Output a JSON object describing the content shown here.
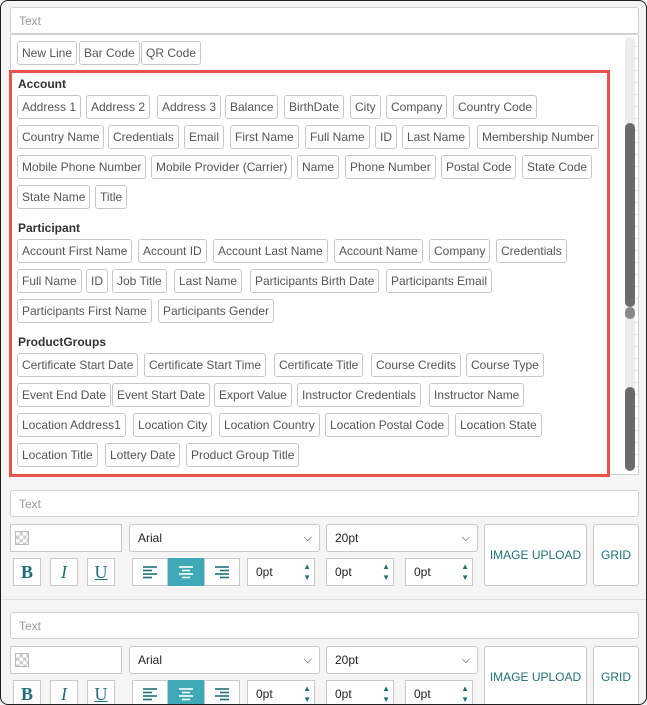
{
  "top_text_placeholder": "Text",
  "basic_chips": [
    "New Line",
    "Bar Code",
    "QR Code"
  ],
  "groups": {
    "account": {
      "title": "Account",
      "items": [
        "Address 1",
        "Address 2",
        "Address 3",
        "Balance",
        "BirthDate",
        "City",
        "Company",
        "Country Code",
        "Country Name",
        "Credentials",
        "Email",
        "First Name",
        "Full Name",
        "ID",
        "Last Name",
        "Membership Number",
        "Mobile Phone Number",
        "Mobile Provider (Carrier)",
        "Name",
        "Phone Number",
        "Postal Code",
        "State Code",
        "State Name",
        "Title"
      ]
    },
    "participant": {
      "title": "Participant",
      "items": [
        "Account First Name",
        "Account ID",
        "Account Last Name",
        "Account Name",
        "Company",
        "Credentials",
        "Full Name",
        "ID",
        "Job Title",
        "Last Name",
        "Participants Birth Date",
        "Participants Email",
        "Participants First Name",
        "Participants Gender"
      ]
    },
    "productgroups": {
      "title": "ProductGroups",
      "items": [
        "Certificate Start Date",
        "Certificate Start Time",
        "Certificate Title",
        "Course Credits",
        "Course Type",
        "Event End Date",
        "Event Start Date",
        "Export Value",
        "Instructor Credentials",
        "Instructor Name",
        "Location Address1",
        "Location City",
        "Location Country",
        "Location Postal Code",
        "Location State",
        "Location Title",
        "Lottery Date",
        "Product Group Title"
      ]
    }
  },
  "editors": [
    {
      "text_placeholder": "Text",
      "font": "Arial",
      "size": "20pt",
      "spin1": "0pt",
      "spin2": "0pt",
      "spin3": "0pt",
      "upload_label": "IMAGE UPLOAD",
      "grid_label": "GRID",
      "bold": "B",
      "italic": "I",
      "underline": "U"
    },
    {
      "text_placeholder": "Text",
      "font": "Arial",
      "size": "20pt",
      "spin1": "0pt",
      "spin2": "0pt",
      "spin3": "0pt",
      "upload_label": "IMAGE UPLOAD",
      "grid_label": "GRID",
      "bold": "B",
      "italic": "I",
      "underline": "U"
    }
  ],
  "colors": {
    "highlight": "#e8544a",
    "accent": "#3fa9b7",
    "accent_text": "#1f6f7a"
  }
}
